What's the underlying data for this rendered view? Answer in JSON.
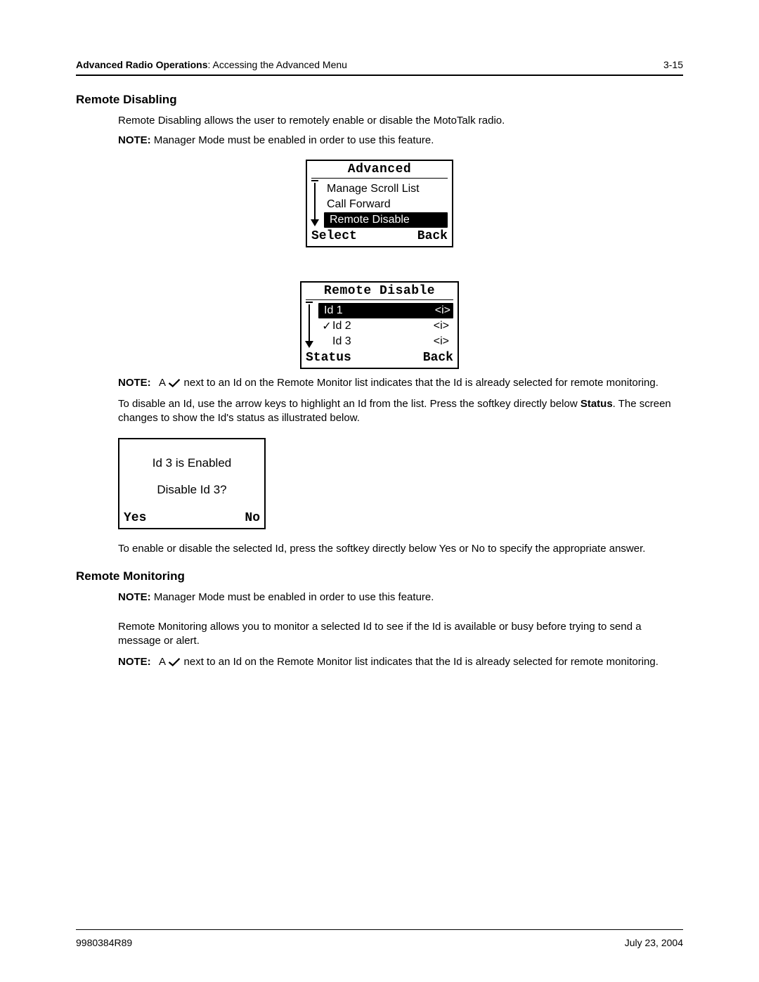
{
  "header": {
    "section": "Advanced Radio Operations",
    "subsection": "Accessing the Advanced Menu",
    "page_num": "3-15"
  },
  "h1": "Remote Disabling",
  "p1": "Remote Disabling allows the user to remotely enable or disable the MotoTalk radio.",
  "note1_label": "NOTE:",
  "note1_text": "Manager Mode must be enabled in order to use this feature.",
  "screen1": {
    "title": "Advanced",
    "items": [
      "Manage Scroll List",
      "Call Forward",
      "Remote Disable"
    ],
    "left": "Select",
    "right": "Back"
  },
  "screen2": {
    "title": "Remote Disable",
    "rows": [
      {
        "check": "",
        "label": "Id 1",
        "info": "<i>"
      },
      {
        "check": "✓",
        "label": "Id 2",
        "info": "<i>"
      },
      {
        "check": "",
        "label": "Id 3",
        "info": "<i>"
      }
    ],
    "left": "Status",
    "right": "Back"
  },
  "note2_label": "NOTE:",
  "note2_text_a": "A ",
  "note2_text_b": " next to an Id on the Remote Monitor list indicates that the Id is already selected for remote monitoring.",
  "p2a": "To disable an Id, use the arrow keys to highlight an Id from the list. Press the softkey directly below ",
  "p2b": "Status",
  "p2c": ". The screen changes to show the Id's status as illustrated below.",
  "screen3": {
    "line1": "Id 3 is Enabled",
    "line2": "Disable Id 3?",
    "left": "Yes",
    "right": "No"
  },
  "p3": "To enable or disable the selected Id, press the softkey directly below Yes or No to specify the appropriate answer.",
  "h2": "Remote Monitoring",
  "note3_label": "NOTE:",
  "note3_text": "Manager Mode must be enabled in order to use this feature.",
  "p4": "Remote Monitoring allows you to monitor a selected Id to see if the Id is available or busy before trying to send a message or alert.",
  "note4_label": "NOTE:",
  "note4_text_a": "A ",
  "note4_text_b": " next to an Id on the Remote Monitor list indicates that the Id is already selected for remote monitoring.",
  "footer": {
    "doc": "9980384R89",
    "date": "July 23, 2004"
  }
}
